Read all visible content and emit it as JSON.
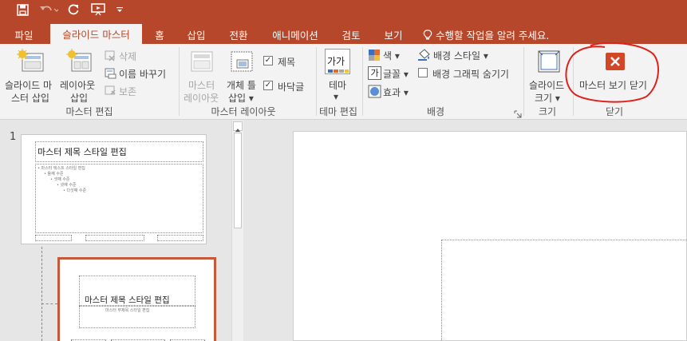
{
  "quick_access": {
    "save_icon": "save-icon",
    "undo_icon": "undo-icon",
    "redo_icon": "repeat-icon",
    "present_icon": "start-from-beginning-icon",
    "customize_icon": "customize-qat-icon"
  },
  "tabs": [
    "파일",
    "슬라이드 마스터",
    "홈",
    "삽입",
    "전환",
    "애니메이션",
    "검토",
    "보기"
  ],
  "tell_me": "수행할 작업을 알려 주세요.",
  "ribbon": {
    "master_edit": {
      "insert_master": [
        "슬라이드 마",
        "스터 삽입"
      ],
      "insert_layout": [
        "레이아웃",
        "삽입"
      ],
      "delete": "삭제",
      "rename": "이름 바꾸기",
      "preserve": "보존",
      "group_label": "마스터 편집"
    },
    "master_layout": {
      "master_layout_btn": [
        "마스터",
        "레이아웃"
      ],
      "insert_placeholder": [
        "개체 틀",
        "삽입"
      ],
      "title_chk": "제목",
      "footer_chk": "바닥글",
      "group_label": "마스터 레이아웃"
    },
    "edit_theme": {
      "theme_btn": "테마",
      "group_label": "테마 편집",
      "theme_glyph": "가가"
    },
    "background": {
      "colors": "색",
      "fonts": "글꼴",
      "effects": "효과",
      "bg_styles": "배경 스타일",
      "hide_bg": "배경 그래픽 숨기기",
      "group_label": "배경"
    },
    "size": {
      "slide_size": [
        "슬라이드",
        "크기"
      ],
      "group_label": "크기"
    },
    "close": {
      "close_master": "마스터 보기 닫기",
      "group_label": "닫기"
    }
  },
  "thumbnails": {
    "slide_number": "1",
    "master": {
      "title": "마스터 제목 스타일 편집",
      "body": [
        "• 마스터 텍스트 스타일 편집",
        "• 둘째 수준",
        "• 셋째 수준",
        "• 넷째 수준",
        "• 다섯째 수준"
      ]
    },
    "layout": {
      "title": "마스터 제목 스타일 편집",
      "subtitle": "마스터 부제목 스타일 편집"
    }
  },
  "colors": {
    "accent": "#b7472a",
    "close_icon": "#d24726",
    "annotation": "#e0201b"
  }
}
